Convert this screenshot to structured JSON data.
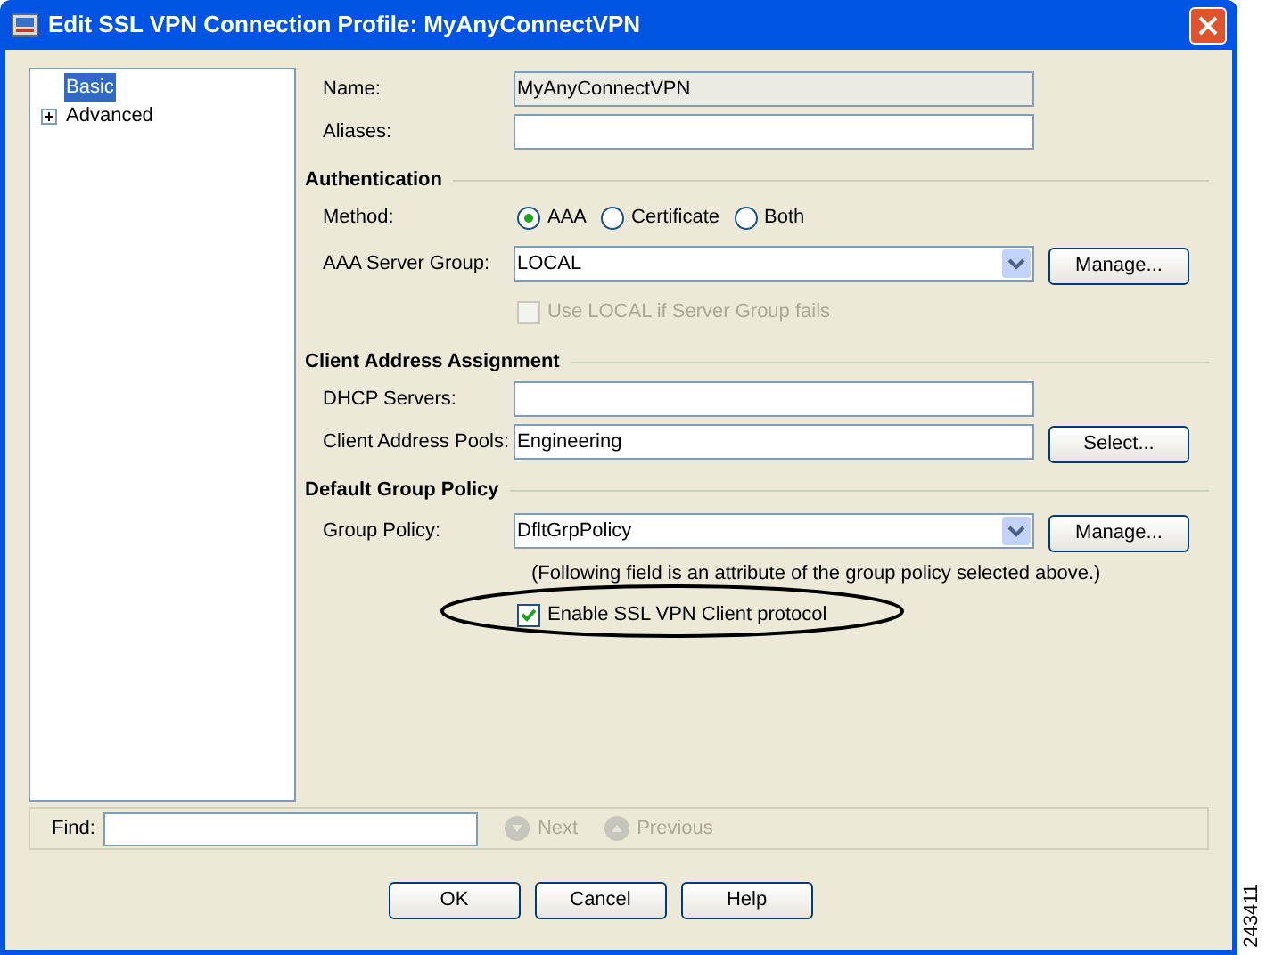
{
  "window": {
    "title": "Edit SSL VPN Connection Profile: MyAnyConnectVPN"
  },
  "tree": [
    {
      "label": "Basic",
      "selected": true,
      "expandable": false
    },
    {
      "label": "Advanced",
      "selected": false,
      "expandable": true
    }
  ],
  "top_rows": [
    {
      "kind": "text",
      "label": "Name:",
      "value": "MyAnyConnectVPN",
      "disabled": true
    },
    {
      "kind": "text",
      "label": "Aliases:",
      "disabled": false
    }
  ],
  "sections": [
    {
      "title": "Authentication",
      "rows": [
        {
          "kind": "radio",
          "label": "Method:",
          "options": [
            {
              "label": "AAA",
              "selected": true
            },
            {
              "label": "Certificate",
              "selected": false
            },
            {
              "label": "Both",
              "selected": false
            }
          ]
        },
        {
          "kind": "select",
          "label": "AAA Server Group:",
          "value": "LOCAL",
          "button": "Manage..."
        },
        {
          "kind": "checkbox",
          "label": "Use LOCAL if Server Group fails",
          "checked": false,
          "disabled": true,
          "circled": false
        }
      ]
    },
    {
      "title": "Client Address Assignment",
      "rows": [
        {
          "kind": "text",
          "label": "DHCP Servers:",
          "disabled": false
        },
        {
          "kind": "text",
          "label": "Client Address Pools:",
          "value": "Engineering",
          "disabled": false,
          "button": "Select..."
        }
      ]
    },
    {
      "title": "Default Group Policy",
      "rows": [
        {
          "kind": "select",
          "label": "Group Policy:",
          "value": "DfltGrpPolicy",
          "button": "Manage..."
        },
        {
          "kind": "note",
          "text": "(Following field is an attribute of the group policy selected above.)"
        },
        {
          "kind": "checkbox",
          "label": "Enable SSL VPN Client protocol",
          "checked": true,
          "disabled": false,
          "circled": true
        }
      ]
    }
  ],
  "find": {
    "label": "Find:",
    "next": "Next",
    "previous": "Previous"
  },
  "buttons": [
    "OK",
    "Cancel",
    "Help"
  ],
  "figure_number": "243411"
}
